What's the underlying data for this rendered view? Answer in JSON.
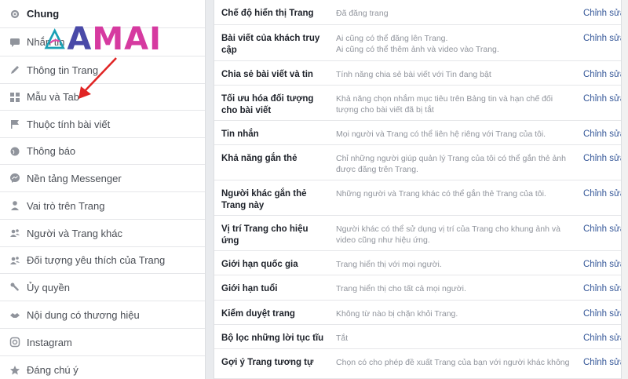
{
  "sidebar": {
    "items": [
      {
        "label": "Chung",
        "icon": "gear-icon",
        "active": true
      },
      {
        "label": "Nhắn tin",
        "icon": "message-icon",
        "active": false
      },
      {
        "label": "Thông tin Trang",
        "icon": "pencil-icon",
        "active": false
      },
      {
        "label": "Mẫu và Tab",
        "icon": "grid-icon",
        "active": false
      },
      {
        "label": "Thuộc tính bài viết",
        "icon": "flag-icon",
        "active": false
      },
      {
        "label": "Thông báo",
        "icon": "globe-icon",
        "active": false
      },
      {
        "label": "Nền tảng Messenger",
        "icon": "messenger-icon",
        "active": false
      },
      {
        "label": "Vai trò trên Trang",
        "icon": "person-icon",
        "active": false
      },
      {
        "label": "Người và Trang khác",
        "icon": "people-icon",
        "active": false
      },
      {
        "label": "Đối tượng yêu thích của Trang",
        "icon": "people-icon",
        "active": false
      },
      {
        "label": "Ủy quyền",
        "icon": "wrench-icon",
        "active": false
      },
      {
        "label": "Nội dung có thương hiệu",
        "icon": "handshake-icon",
        "active": false
      },
      {
        "label": "Instagram",
        "icon": "instagram-icon",
        "active": false
      },
      {
        "label": "Đáng chú ý",
        "icon": "star-icon",
        "active": false
      }
    ]
  },
  "watermark": {
    "part1": "A",
    "part2": "MAI"
  },
  "settings": {
    "edit_label": "Chỉnh sửa",
    "rows": [
      {
        "name": "Chế độ hiển thị Trang",
        "desc": [
          "Đã đăng trang"
        ]
      },
      {
        "name": "Bài viết của khách truy cập",
        "desc": [
          "Ai cũng có thể đăng lên Trang.",
          "Ai cũng có thể thêm ảnh và video vào Trang."
        ]
      },
      {
        "name": "Chia sẻ bài viết và tin",
        "desc": [
          "Tính năng chia sẻ bài viết với Tin đang bật"
        ]
      },
      {
        "name": "Tối ưu hóa đối tượng cho bài viết",
        "desc": [
          "Khả năng chọn nhắm mục tiêu trên Bảng tin và hạn chế đối",
          "tượng cho bài viết đã bị tắt"
        ]
      },
      {
        "name": "Tin nhắn",
        "desc": [
          "Mọi người và Trang có thể liên hệ riêng với Trang của tôi."
        ]
      },
      {
        "name": "Khả năng gắn thẻ",
        "desc": [
          "Chỉ những người giúp quản lý Trang của tôi có thể gắn thẻ ảnh",
          "được đăng trên Trang."
        ]
      },
      {
        "name": "Người khác gắn thẻ Trang này",
        "desc": [
          "Những người và Trang khác có thể gắn thẻ Trang của tôi."
        ]
      },
      {
        "name": "Vị trí Trang cho hiệu ứng",
        "desc": [
          "Người khác có thể sử dụng vị trí của Trang cho khung ảnh và",
          "video cũng như hiệu ứng."
        ]
      },
      {
        "name": "Giới hạn quốc gia",
        "desc": [
          "Trang hiển thị với mọi người."
        ]
      },
      {
        "name": "Giới hạn tuổi",
        "desc": [
          "Trang hiển thị cho tất cả mọi người."
        ]
      },
      {
        "name": "Kiểm duyệt trang",
        "desc": [
          "Không từ nào bị chặn khỏi Trang."
        ]
      },
      {
        "name": "Bộ lọc những lời tục tĩu",
        "desc": [
          "Tắt"
        ]
      },
      {
        "name": "Gợi ý Trang tương tự",
        "desc": [
          "Chọn có cho phép đề xuất Trang của bạn với người khác không"
        ]
      }
    ]
  }
}
